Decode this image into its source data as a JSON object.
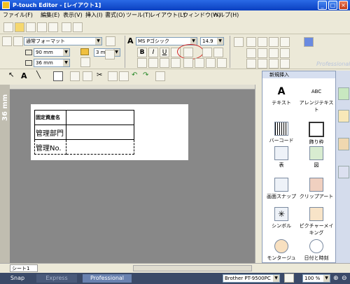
{
  "window": {
    "title": "P-touch Editor - [レイアウト1]"
  },
  "menu": [
    "ファイル(F)",
    "編集(E)",
    "表示(V)",
    "挿入(I)",
    "書式(O)",
    "ツール(T)",
    "レイアウト(L)",
    "ウィンドウ(W)",
    "ヘルプ(H)"
  ],
  "format_bar": {
    "paper_format": "通常フォーマット",
    "width": "90 mm",
    "margin": "3 mm",
    "height": "36 mm",
    "font": "MS Pゴシック",
    "font_size": "14.9"
  },
  "ruler": {
    "label": "36 mm"
  },
  "label_table": {
    "rows": [
      "固定資産名",
      "管理部門",
      "管理No."
    ]
  },
  "side_panel": {
    "title": "新規挿入",
    "watermark": "Professional",
    "items": [
      "テキスト",
      "アレンジテキスト",
      "バーコード",
      "飾り枠",
      "表",
      "図",
      "画面スナップ",
      "クリップアート",
      "シンボル",
      "ピクチャーメイキング",
      "モンタージュ",
      "日付と時刻"
    ]
  },
  "sheet_tab": "シート1",
  "status": {
    "printer": "Brother PT-9500PC",
    "zoom": "100 %"
  },
  "modes": {
    "snap": "Snap",
    "express": "Express",
    "professional": "Professional"
  }
}
